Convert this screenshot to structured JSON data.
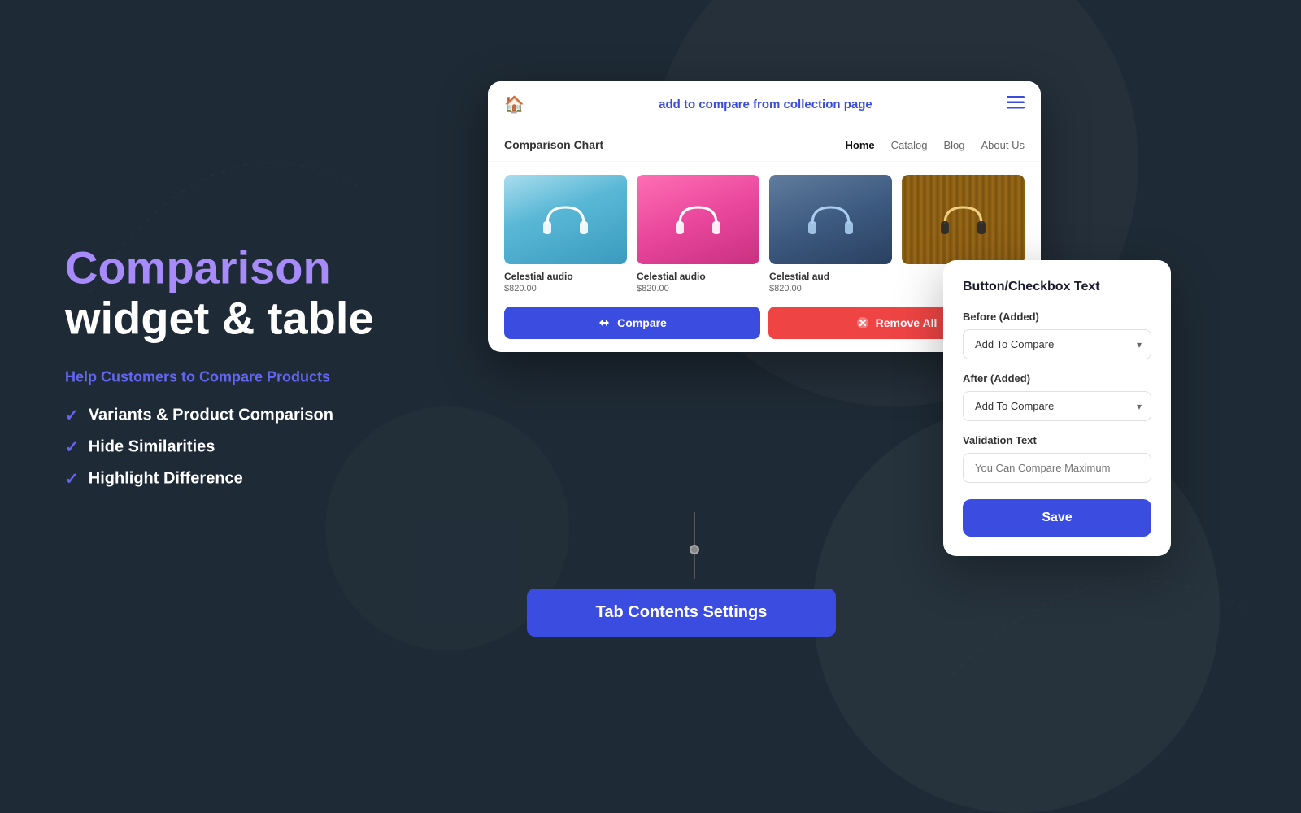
{
  "background": {
    "color": "#1e2a35"
  },
  "left_panel": {
    "title_highlight": "Comparison",
    "title_normal": "widget & table",
    "subtitle": "Help Customers to Compare Products",
    "features": [
      {
        "id": "feature-1",
        "text": "Variants & Product Comparison"
      },
      {
        "id": "feature-2",
        "text": "Hide Similarities"
      },
      {
        "id": "feature-3",
        "text": "Highlight Difference"
      }
    ]
  },
  "main_window": {
    "header": {
      "title": "add to compare from collection page",
      "home_icon": "🏠",
      "menu_icon": "≡"
    },
    "store_nav": {
      "brand": "Comparison Chart",
      "links": [
        {
          "label": "Home",
          "active": true
        },
        {
          "label": "Catalog",
          "active": false
        },
        {
          "label": "Blog",
          "active": false
        },
        {
          "label": "About Us",
          "active": false
        }
      ]
    },
    "products": [
      {
        "id": "product-1",
        "name": "Celestial audio",
        "price": "$820.00",
        "image_type": "blue"
      },
      {
        "id": "product-2",
        "name": "Celestial audio",
        "price": "$820.00",
        "image_type": "pink"
      },
      {
        "id": "product-3",
        "name": "Celestial aud",
        "price": "$820.00",
        "image_type": "darkblue"
      },
      {
        "id": "product-4",
        "name": "",
        "price": "",
        "image_type": "wood"
      }
    ],
    "actions": {
      "compare_label": "Compare",
      "remove_label": "Remove All"
    }
  },
  "tab_settings_button": {
    "label": "Tab Contents Settings"
  },
  "settings_panel": {
    "title": "Button/Checkbox Text",
    "before_label": "Before (Added)",
    "before_value": "Add To Compare",
    "after_label": "After (Added)",
    "after_value": "Add To Compare",
    "validation_label": "Validation Text",
    "validation_placeholder": "You Can Compare Maximum",
    "save_label": "Save"
  }
}
